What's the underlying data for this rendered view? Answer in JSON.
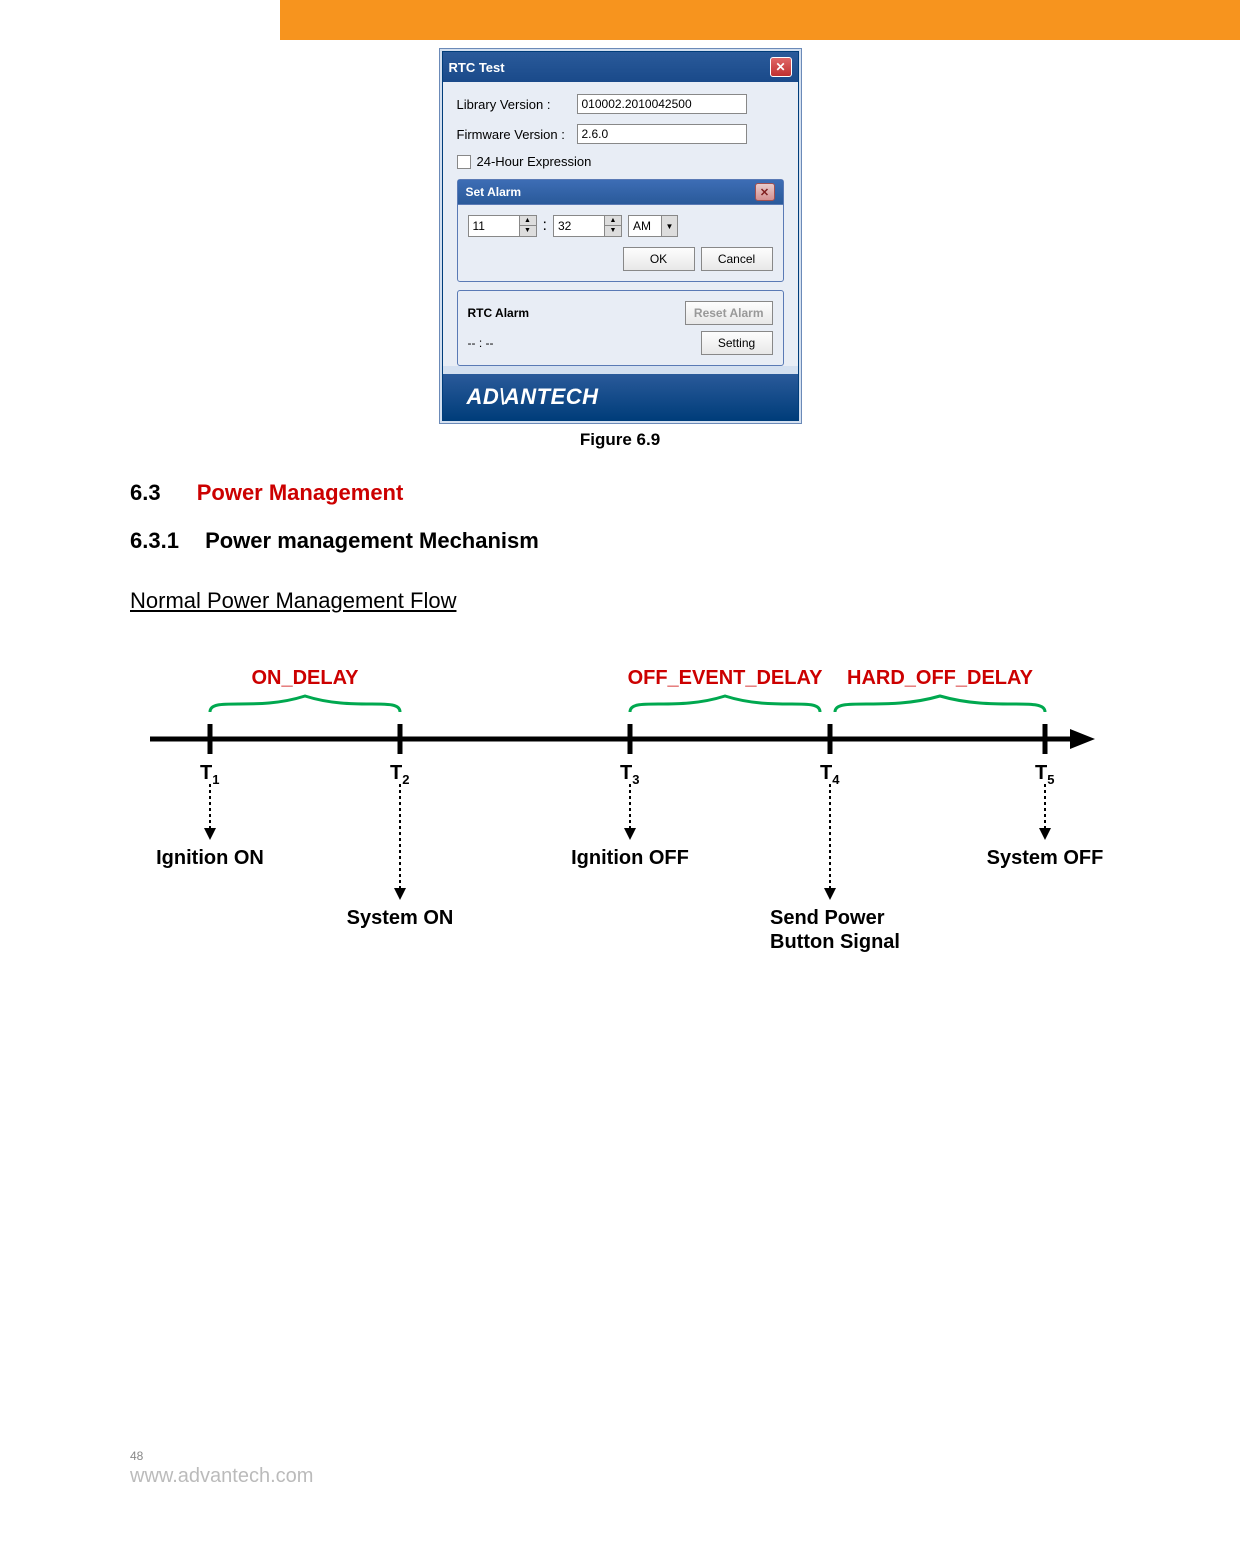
{
  "dialog": {
    "title": "RTC Test",
    "library_label": "Library Version :",
    "library_value": "010002.2010042500",
    "firmware_label": "Firmware Version :",
    "firmware_value": "2.6.0",
    "chk24_label": "24-Hour Expression",
    "set_alarm_title": "Set Alarm",
    "hour_value": "11",
    "minute_value": "32",
    "ampm_value": "AM",
    "ok": "OK",
    "cancel": "Cancel",
    "rtc_alarm": "RTC Alarm",
    "reset_alarm": "Reset Alarm",
    "setting": "Setting",
    "nn": "-- : --",
    "logo": "ADVANTECH"
  },
  "caption": "Figure 6.9",
  "section": {
    "num": "6.3",
    "title": "Power Management"
  },
  "subsection": {
    "num": "6.3.1",
    "title": "Power management Mechanism"
  },
  "flow_title": "Normal Power Management Flow",
  "diagram": {
    "on_delay": "ON_DELAY",
    "off_event_delay": "OFF_EVENT_DELAY",
    "hard_off_delay": "HARD_OFF_DELAY",
    "t1": "T",
    "t1s": "1",
    "t2": "T",
    "t2s": "2",
    "t3": "T",
    "t3s": "3",
    "t4": "T",
    "t4s": "4",
    "t5": "T",
    "t5s": "5",
    "ignition_on": "Ignition ON",
    "system_on": "System ON",
    "ignition_off": "Ignition OFF",
    "send_power": "Send Power",
    "button_signal": "Button Signal",
    "system_off": "System OFF"
  },
  "footer": {
    "page": "48",
    "url": "www.advantech.com"
  }
}
